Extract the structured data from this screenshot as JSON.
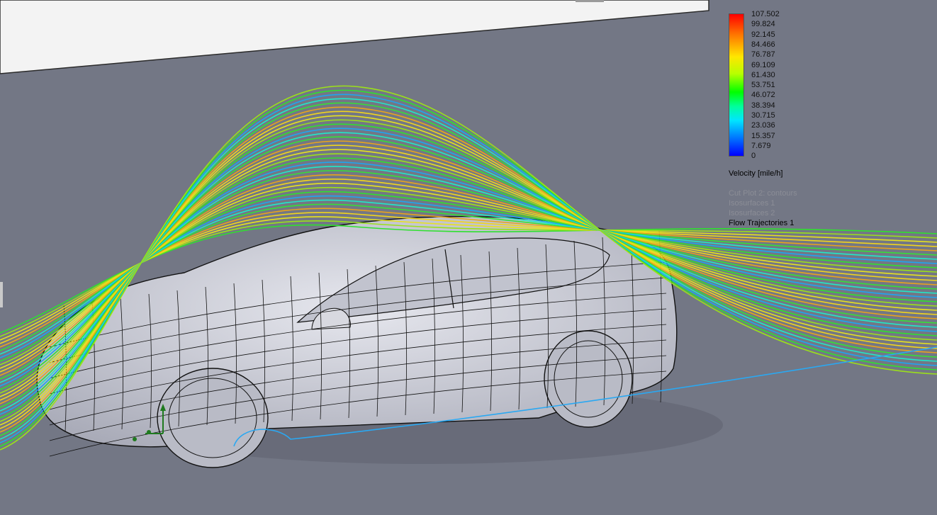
{
  "legend": {
    "ticks": [
      "107.502",
      "99.824",
      "92.145",
      "84.466",
      "76.787",
      "69.109",
      "61.430",
      "53.751",
      "46.072",
      "38.394",
      "30.715",
      "23.036",
      "15.357",
      "7.679",
      "0"
    ],
    "quantity": "Velocity [mile/h]",
    "plots": [
      {
        "label": "Cut Plot 2: contours",
        "active": false
      },
      {
        "label": "Isosurfaces 1",
        "active": false
      },
      {
        "label": "Isosurfaces 2",
        "active": false
      },
      {
        "label": "Flow Trajectories 1",
        "active": true
      }
    ]
  },
  "colors": {
    "background": "#737785",
    "wall": "#f2f2f2",
    "car_body": "#c8cad6"
  }
}
